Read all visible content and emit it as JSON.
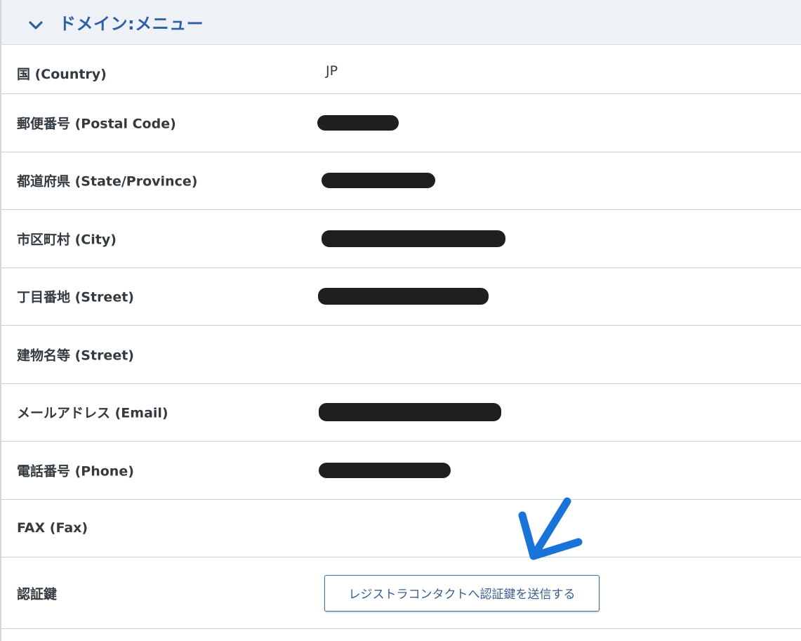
{
  "header": {
    "title": "ドメイン:メニュー",
    "toggle_icon": "chevron-down-icon",
    "accent_color": "#2f5fa3"
  },
  "rows": [
    {
      "label": "国 (Country)",
      "value": "JP"
    },
    {
      "label": "郵便番号 (Postal Code)",
      "value": null,
      "redacted": true
    },
    {
      "label": "都道府県 (State/Province)",
      "value": null,
      "redacted": true
    },
    {
      "label": "市区町村 (City)",
      "value": null,
      "redacted": true
    },
    {
      "label": "丁目番地 (Street)",
      "value": null,
      "redacted": true
    },
    {
      "label": "建物名等 (Street)",
      "value": ""
    },
    {
      "label": "メールアドレス (Email)",
      "value": null,
      "redacted": true
    },
    {
      "label": "電話番号 (Phone)",
      "value": null,
      "redacted": true
    },
    {
      "label": "FAX (Fax)",
      "value": ""
    },
    {
      "label": "認証鍵",
      "button_label": "レジストラコンタクトへ認証鍵を送信する"
    }
  ],
  "annotation": {
    "icon": "blue-arrow-annotation-icon",
    "color": "#1a73d9"
  }
}
